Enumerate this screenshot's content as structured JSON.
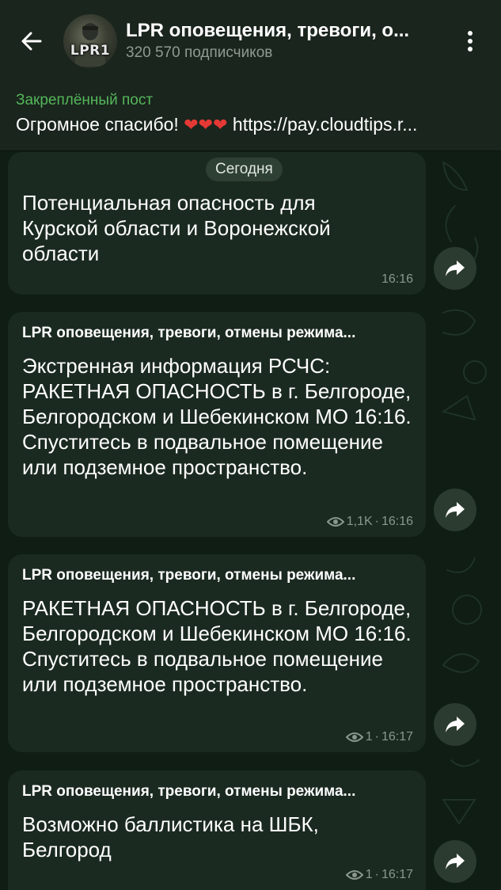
{
  "header": {
    "title": "LPR оповещения, тревоги, о...",
    "subscribers": "320 570 подписчиков",
    "avatar_text": "LPR1",
    "back_icon": "arrow-left-icon",
    "menu_icon": "more-vertical-icon"
  },
  "pinned": {
    "label": "Закреплённый пост",
    "text_before": "Огромное спасибо! ",
    "hearts": "❤❤❤",
    "text_after": " https://pay.cloudtips.r..."
  },
  "date_chip": "Сегодня",
  "messages": [
    {
      "sender": "",
      "text": "Потенциальная опасность для Курской области и Воронежской области",
      "views": "",
      "time": "16:16"
    },
    {
      "sender": "LPR оповещения, тревоги, отмены режима...",
      "text": "Экстренная информация РСЧС: РАКЕТНАЯ ОПАСНОСТЬ в г. Белгороде, Белгородском и Шебекинском МО 16:16. Спуститесь в подвальное помещение или подземное пространство.",
      "views": "1,1K",
      "time": "16:16"
    },
    {
      "sender": "LPR оповещения, тревоги, отмены режима...",
      "text": "РАКЕТНАЯ ОПАСНОСТЬ в г. Белгороде, Белгородском и Шебекинском МО 16:16. Спуститесь в подвальное помещение или подземное пространство.",
      "views": "1",
      "time": "16:17"
    },
    {
      "sender": "LPR оповещения, тревоги, отмены режима...",
      "text": "Возможно баллистика на ШБК, Белгород",
      "views": "1",
      "time": "16:17"
    }
  ],
  "colors": {
    "header_bg": "#1a251d",
    "bubble_bg": "#1b2a20",
    "accent_green": "#54b75a",
    "meta_text": "#8a978d"
  }
}
